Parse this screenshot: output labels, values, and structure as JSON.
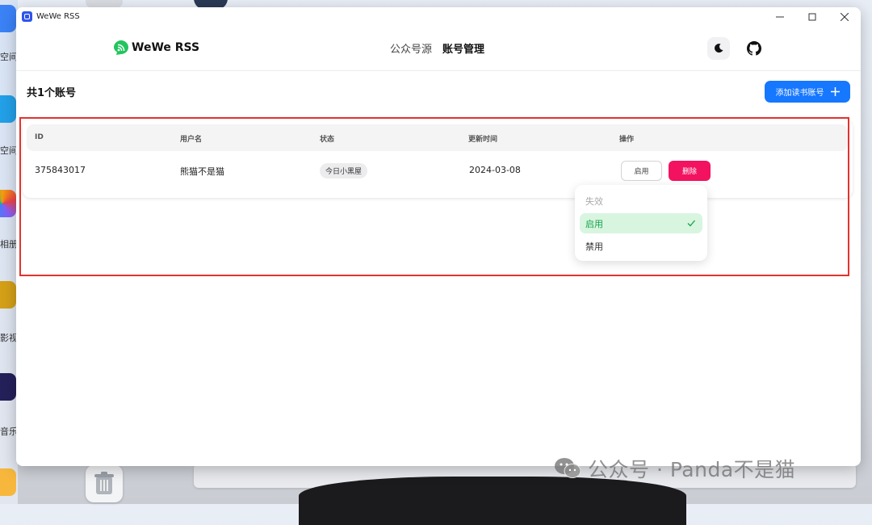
{
  "window": {
    "title": "WeWe RSS"
  },
  "navbar": {
    "brand": "WeWe RSS",
    "links": [
      {
        "label": "公众号源",
        "active": false
      },
      {
        "label": "账号管理",
        "active": true
      }
    ]
  },
  "page": {
    "count_title": "共1个账号",
    "add_button_label": "添加读书账号"
  },
  "table": {
    "headers": [
      "ID",
      "用户名",
      "状态",
      "更新时间",
      "操作"
    ],
    "rows": [
      {
        "id": "375843017",
        "username": "熊猫不是猫",
        "status": "今日小黑屋",
        "updated": "2024-03-08",
        "enable_label": "启用",
        "delete_label": "删除"
      }
    ]
  },
  "dropdown": {
    "options": [
      {
        "label": "失效",
        "state": "disabled"
      },
      {
        "label": "启用",
        "state": "selected"
      },
      {
        "label": "禁用",
        "state": "normal"
      }
    ]
  },
  "desktop": {
    "labels": [
      "空间",
      "空间",
      "相册",
      "影视",
      "音乐"
    ]
  },
  "watermark": "公众号 · Panda不是猫",
  "colors": {
    "primary": "#1677ff",
    "danger": "#f31260",
    "success": "#17a34a",
    "highlight": "#e5322d"
  }
}
